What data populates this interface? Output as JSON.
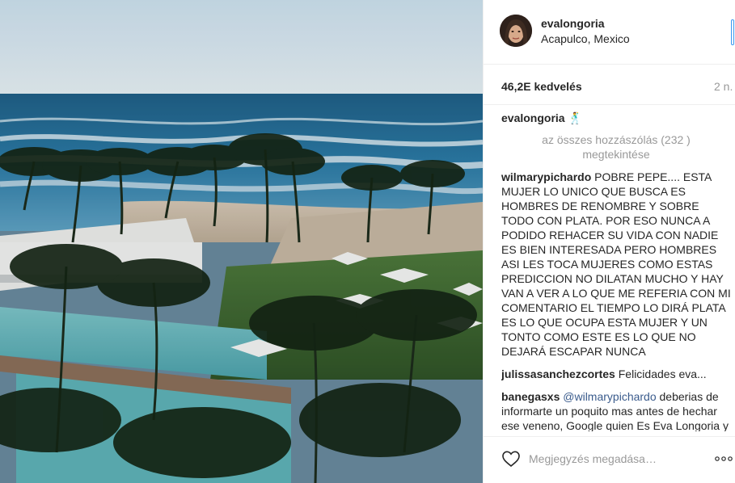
{
  "post": {
    "username": "evalongoria",
    "location": "Acapulco, Mexico",
    "likes": "46,2E kedvelés",
    "time": "2 n.",
    "caption_suffix": "🕺",
    "view_all_label": "az összes hozzászólás (232 ) megtekintése"
  },
  "comments": [
    {
      "username": "wilmarypichardo",
      "text": "POBRE PEPE.... ESTA MUJER LO UNICO QUE BUSCA ES HOMBRES DE RENOMBRE Y SOBRE TODO CON PLATA. POR ESO NUNCA A PODIDO REHACER SU VIDA CON NADIE ES BIEN INTERESADA PERO HOMBRES ASI LES TOCA MUJERES COMO ESTAS PREDICCION NO DILATAN MUCHO Y HAY VAN A VER A LO QUE ME REFERIA CON MI COMENTARIO EL TIEMPO LO DIRÁ PLATA ES LO QUE OCUPA ESTA MUJER Y UN TONTO COMO ESTE ES LO QUE NO DEJARÁ ESCAPAR NUNCA"
    },
    {
      "username": "julissasanchezcortes",
      "text": "Felicidades eva..."
    },
    {
      "username": "banegasxs",
      "mention": "@wilmarypichardo",
      "text": "deberias de informarte un poquito mas antes de hechar ese veneno, Google quien Es Eva Longoria y lo que vale solo su nombre"
    }
  ],
  "footer": {
    "comment_placeholder": "Megjegyzés megadása…",
    "more_icon": "ellipsis-icon",
    "like_icon": "heart-outline-icon"
  },
  "colors": {
    "link": "#3a5b8c",
    "muted": "#999999",
    "text": "#262626",
    "follow_accent": "#3897f0"
  }
}
